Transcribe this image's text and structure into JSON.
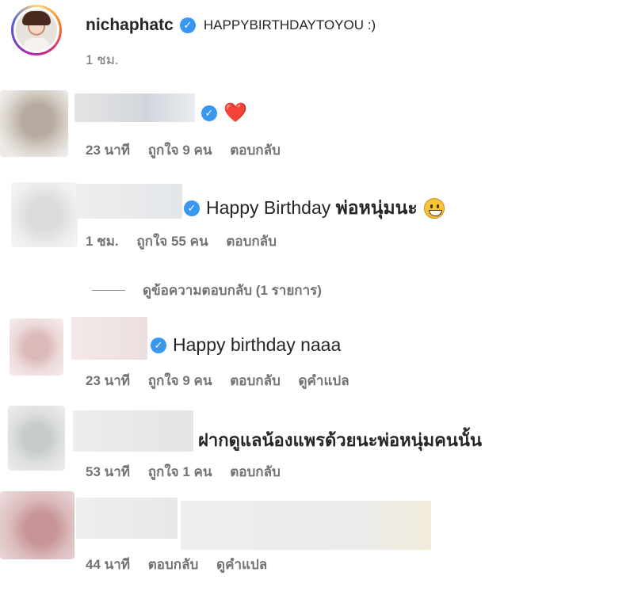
{
  "post": {
    "username": "nichaphatc",
    "caption": "HAPPYBIRTHDAYTOYOU :)",
    "time": "1 ชม."
  },
  "icons": {
    "verified": "verified-badge-icon",
    "heart": "red-heart-emoji-icon",
    "grin": "grinning-face-emoji-icon"
  },
  "colors": {
    "verified": "#3897f0",
    "meta": "#737373",
    "heart": "#e0202a"
  },
  "comments": [
    {
      "text": "❤️",
      "time": "23 นาที",
      "likes": "ถูกใจ 9 คน",
      "reply": "ตอบกลับ"
    },
    {
      "text": "Happy Birthday ",
      "text_bold": "พ่อหนุ่มนะ",
      "time": "1 ชม.",
      "likes": "ถูกใจ 55 คน",
      "reply": "ตอบกลับ",
      "view_replies": "ดูข้อความตอบกลับ (1 รายการ)"
    },
    {
      "text": "Happy birthday naaa",
      "time": "23 นาที",
      "likes": "ถูกใจ 9 คน",
      "reply": "ตอบกลับ",
      "translate": "ดูคำแปล"
    },
    {
      "text": "ฝากดูแลน้องแพรด้วยนะพ่อหนุ่มคนนั้น",
      "time": "53 นาที",
      "likes": "ถูกใจ 1 คน",
      "reply": "ตอบกลับ"
    },
    {
      "time": "44 นาที",
      "reply": "ตอบกลับ",
      "translate": "ดูคำแปล"
    }
  ]
}
